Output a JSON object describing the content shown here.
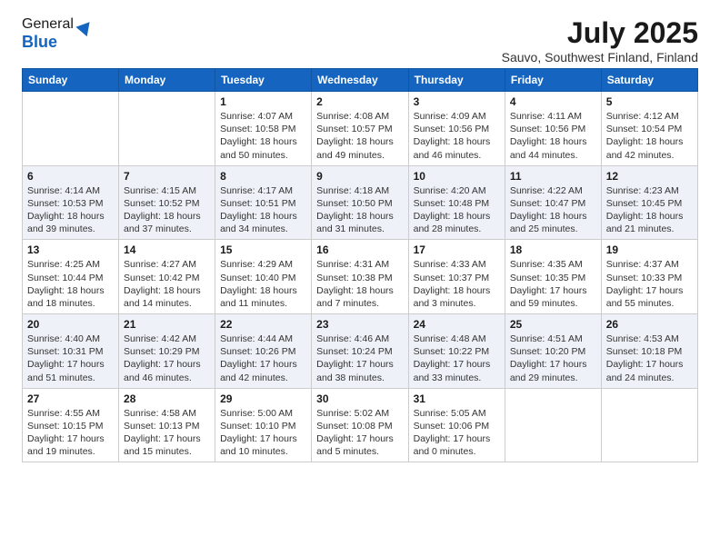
{
  "header": {
    "logo_general": "General",
    "logo_blue": "Blue",
    "title": "July 2025",
    "location": "Sauvo, Southwest Finland, Finland"
  },
  "weekdays": [
    "Sunday",
    "Monday",
    "Tuesday",
    "Wednesday",
    "Thursday",
    "Friday",
    "Saturday"
  ],
  "weeks": [
    [
      {
        "day": "",
        "detail": ""
      },
      {
        "day": "",
        "detail": ""
      },
      {
        "day": "1",
        "detail": "Sunrise: 4:07 AM\nSunset: 10:58 PM\nDaylight: 18 hours\nand 50 minutes."
      },
      {
        "day": "2",
        "detail": "Sunrise: 4:08 AM\nSunset: 10:57 PM\nDaylight: 18 hours\nand 49 minutes."
      },
      {
        "day": "3",
        "detail": "Sunrise: 4:09 AM\nSunset: 10:56 PM\nDaylight: 18 hours\nand 46 minutes."
      },
      {
        "day": "4",
        "detail": "Sunrise: 4:11 AM\nSunset: 10:56 PM\nDaylight: 18 hours\nand 44 minutes."
      },
      {
        "day": "5",
        "detail": "Sunrise: 4:12 AM\nSunset: 10:54 PM\nDaylight: 18 hours\nand 42 minutes."
      }
    ],
    [
      {
        "day": "6",
        "detail": "Sunrise: 4:14 AM\nSunset: 10:53 PM\nDaylight: 18 hours\nand 39 minutes."
      },
      {
        "day": "7",
        "detail": "Sunrise: 4:15 AM\nSunset: 10:52 PM\nDaylight: 18 hours\nand 37 minutes."
      },
      {
        "day": "8",
        "detail": "Sunrise: 4:17 AM\nSunset: 10:51 PM\nDaylight: 18 hours\nand 34 minutes."
      },
      {
        "day": "9",
        "detail": "Sunrise: 4:18 AM\nSunset: 10:50 PM\nDaylight: 18 hours\nand 31 minutes."
      },
      {
        "day": "10",
        "detail": "Sunrise: 4:20 AM\nSunset: 10:48 PM\nDaylight: 18 hours\nand 28 minutes."
      },
      {
        "day": "11",
        "detail": "Sunrise: 4:22 AM\nSunset: 10:47 PM\nDaylight: 18 hours\nand 25 minutes."
      },
      {
        "day": "12",
        "detail": "Sunrise: 4:23 AM\nSunset: 10:45 PM\nDaylight: 18 hours\nand 21 minutes."
      }
    ],
    [
      {
        "day": "13",
        "detail": "Sunrise: 4:25 AM\nSunset: 10:44 PM\nDaylight: 18 hours\nand 18 minutes."
      },
      {
        "day": "14",
        "detail": "Sunrise: 4:27 AM\nSunset: 10:42 PM\nDaylight: 18 hours\nand 14 minutes."
      },
      {
        "day": "15",
        "detail": "Sunrise: 4:29 AM\nSunset: 10:40 PM\nDaylight: 18 hours\nand 11 minutes."
      },
      {
        "day": "16",
        "detail": "Sunrise: 4:31 AM\nSunset: 10:38 PM\nDaylight: 18 hours\nand 7 minutes."
      },
      {
        "day": "17",
        "detail": "Sunrise: 4:33 AM\nSunset: 10:37 PM\nDaylight: 18 hours\nand 3 minutes."
      },
      {
        "day": "18",
        "detail": "Sunrise: 4:35 AM\nSunset: 10:35 PM\nDaylight: 17 hours\nand 59 minutes."
      },
      {
        "day": "19",
        "detail": "Sunrise: 4:37 AM\nSunset: 10:33 PM\nDaylight: 17 hours\nand 55 minutes."
      }
    ],
    [
      {
        "day": "20",
        "detail": "Sunrise: 4:40 AM\nSunset: 10:31 PM\nDaylight: 17 hours\nand 51 minutes."
      },
      {
        "day": "21",
        "detail": "Sunrise: 4:42 AM\nSunset: 10:29 PM\nDaylight: 17 hours\nand 46 minutes."
      },
      {
        "day": "22",
        "detail": "Sunrise: 4:44 AM\nSunset: 10:26 PM\nDaylight: 17 hours\nand 42 minutes."
      },
      {
        "day": "23",
        "detail": "Sunrise: 4:46 AM\nSunset: 10:24 PM\nDaylight: 17 hours\nand 38 minutes."
      },
      {
        "day": "24",
        "detail": "Sunrise: 4:48 AM\nSunset: 10:22 PM\nDaylight: 17 hours\nand 33 minutes."
      },
      {
        "day": "25",
        "detail": "Sunrise: 4:51 AM\nSunset: 10:20 PM\nDaylight: 17 hours\nand 29 minutes."
      },
      {
        "day": "26",
        "detail": "Sunrise: 4:53 AM\nSunset: 10:18 PM\nDaylight: 17 hours\nand 24 minutes."
      }
    ],
    [
      {
        "day": "27",
        "detail": "Sunrise: 4:55 AM\nSunset: 10:15 PM\nDaylight: 17 hours\nand 19 minutes."
      },
      {
        "day": "28",
        "detail": "Sunrise: 4:58 AM\nSunset: 10:13 PM\nDaylight: 17 hours\nand 15 minutes."
      },
      {
        "day": "29",
        "detail": "Sunrise: 5:00 AM\nSunset: 10:10 PM\nDaylight: 17 hours\nand 10 minutes."
      },
      {
        "day": "30",
        "detail": "Sunrise: 5:02 AM\nSunset: 10:08 PM\nDaylight: 17 hours\nand 5 minutes."
      },
      {
        "day": "31",
        "detail": "Sunrise: 5:05 AM\nSunset: 10:06 PM\nDaylight: 17 hours\nand 0 minutes."
      },
      {
        "day": "",
        "detail": ""
      },
      {
        "day": "",
        "detail": ""
      }
    ]
  ]
}
